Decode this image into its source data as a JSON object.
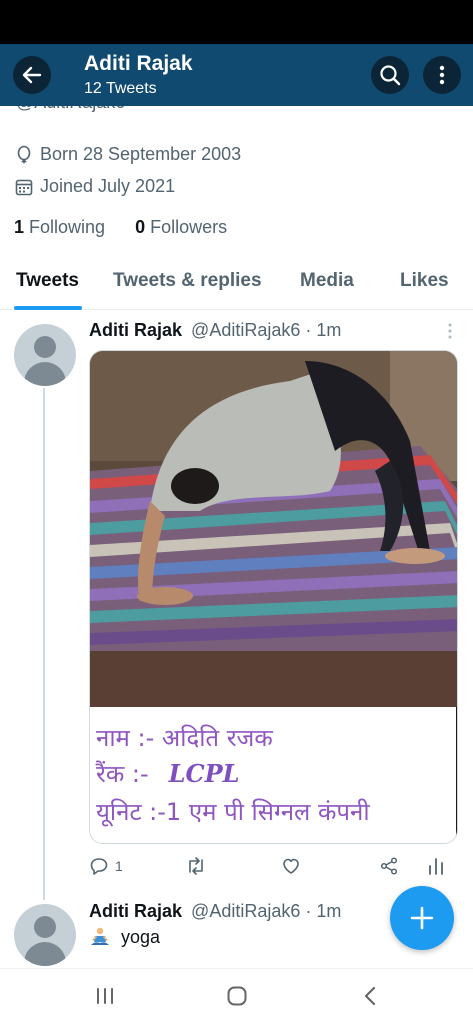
{
  "header": {
    "title": "Aditi Rajak",
    "subtitle": "12 Tweets",
    "colors": {
      "bar": "#114a70",
      "button": "#0b2537"
    }
  },
  "profile": {
    "handle_partial": "@AditiRajak6",
    "born": "Born 28 September 2003",
    "joined": "Joined July 2021",
    "following_count": "1",
    "following_label": "Following",
    "followers_count": "0",
    "followers_label": "Followers"
  },
  "tabs": [
    {
      "label": "Tweets",
      "active": true
    },
    {
      "label": "Tweets & replies",
      "active": false
    },
    {
      "label": "Media",
      "active": false
    },
    {
      "label": "Likes",
      "active": false
    }
  ],
  "tweets": [
    {
      "name": "Aditi Rajak",
      "handle": "@AditiRajak6",
      "separator": "·",
      "time": "1m",
      "media_caption": {
        "line1": "नाम :- अदिति रजक",
        "line2_label": "रैंक :-",
        "line2_value": "LCPL",
        "line3": "यूनिट :-1 एम पी सिग्नल कंपनी"
      },
      "actions": {
        "reply_count": "1",
        "retweet_count": "",
        "like_count": ""
      }
    },
    {
      "name": "Aditi Rajak",
      "handle": "@AditiRajak6",
      "separator": "·",
      "time": "1m",
      "text": "yoga",
      "emoji_icon": "person-in-lotus-position-icon"
    }
  ],
  "accent": "#1d9bf0"
}
